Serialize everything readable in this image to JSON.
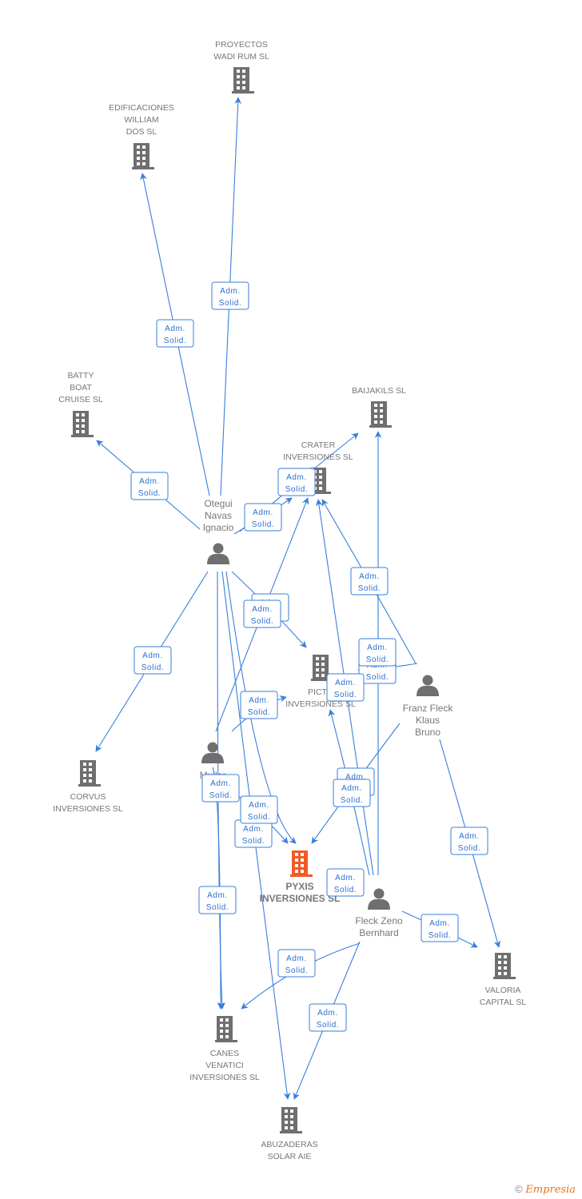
{
  "colors": {
    "edge": "#3a7fdc",
    "node": "#6f6f6f",
    "main_node": "#f05a28"
  },
  "nodes": [
    {
      "id": "proyectos",
      "type": "company",
      "lines": [
        "PROYECTOS",
        "WADI RUM SL"
      ]
    },
    {
      "id": "edificaciones",
      "type": "company",
      "lines": [
        "EDIFICACIONES",
        "WILLIAM",
        "DOS SL"
      ]
    },
    {
      "id": "batty",
      "type": "company",
      "lines": [
        "BATTY",
        "BOAT",
        "CRUISE SL"
      ]
    },
    {
      "id": "baijakils",
      "type": "company",
      "lines": [
        "BAIJAKILS SL"
      ]
    },
    {
      "id": "crater",
      "type": "company",
      "lines": [
        "CRATER",
        "INVERSIONES SL"
      ]
    },
    {
      "id": "otegui",
      "type": "person",
      "lines": [
        "Otegui",
        "Navas",
        "Ignacio"
      ]
    },
    {
      "id": "picto",
      "type": "company",
      "lines": [
        "PICTO",
        "INVERSIONES SL"
      ]
    },
    {
      "id": "franz",
      "type": "person",
      "lines": [
        "Franz Fleck",
        "Klaus",
        "Bruno"
      ]
    },
    {
      "id": "corvus",
      "type": "company",
      "lines": [
        "CORVUS",
        "INVERSIONES SL"
      ]
    },
    {
      "id": "muller",
      "type": "person",
      "lines": [
        "Muller",
        "Je"
      ]
    },
    {
      "id": "pyxis",
      "type": "main",
      "lines": [
        "PYXIS",
        "INVERSIONES SL"
      ]
    },
    {
      "id": "zeno",
      "type": "person",
      "lines": [
        "Fleck Zeno",
        "Bernhard"
      ]
    },
    {
      "id": "valoria",
      "type": "company",
      "lines": [
        "VALORIA",
        "CAPITAL SL"
      ]
    },
    {
      "id": "canes",
      "type": "company",
      "lines": [
        "CANES",
        "VENATICI",
        "INVERSIONES SL"
      ]
    },
    {
      "id": "abuzaderas",
      "type": "company",
      "lines": [
        "ABUZADERAS",
        "SOLAR AIE"
      ]
    }
  ],
  "edges": [
    {
      "from": "otegui",
      "to": "proyectos",
      "role": [
        "Adm.",
        "Solid."
      ]
    },
    {
      "from": "otegui",
      "to": "edificaciones",
      "role": [
        "Adm.",
        "Solid."
      ]
    },
    {
      "from": "otegui",
      "to": "batty",
      "role": [
        "Adm.",
        "Solid."
      ]
    },
    {
      "from": "otegui",
      "to": "crater",
      "role": [
        "Adm.",
        "Solid."
      ]
    },
    {
      "from": "otegui",
      "to": "baijakils",
      "role": [
        "Adm.",
        "Solid."
      ]
    },
    {
      "from": "otegui",
      "to": "picto",
      "role": [
        "Adm.",
        "Solid."
      ]
    },
    {
      "from": "otegui",
      "to": "corvus",
      "role": [
        "Adm.",
        "Solid."
      ]
    },
    {
      "from": "otegui",
      "to": "canes",
      "role": [
        "Adm.",
        "Solid."
      ]
    },
    {
      "from": "otegui",
      "to": "pyxis",
      "role": [
        "Adm.",
        "Solid."
      ]
    },
    {
      "from": "otegui",
      "to": "abuzaderas",
      "role": [
        "Adm.",
        "Solid."
      ]
    },
    {
      "from": "muller",
      "to": "crater",
      "role": [
        "Adm.",
        "Solid."
      ]
    },
    {
      "from": "muller",
      "to": "picto",
      "role": [
        "Adm.",
        "Solid."
      ]
    },
    {
      "from": "muller",
      "to": "canes",
      "role": [
        "Adm.",
        "Solid."
      ]
    },
    {
      "from": "muller",
      "to": "pyxis",
      "role": [
        "Adm.",
        "Solid."
      ]
    },
    {
      "from": "franz",
      "to": "crater",
      "role": [
        "Adm.",
        "Solid."
      ]
    },
    {
      "from": "franz",
      "to": "picto",
      "role": [
        "Adm.",
        "Solid."
      ]
    },
    {
      "from": "franz",
      "to": "pyxis",
      "role": [
        "Adm.",
        "Solid."
      ]
    },
    {
      "from": "franz",
      "to": "valoria",
      "role": [
        "Adm.",
        "Solid."
      ]
    },
    {
      "from": "zeno",
      "to": "baijakils",
      "role": [
        "Adm.",
        "Solid."
      ]
    },
    {
      "from": "zeno",
      "to": "crater",
      "role": [
        "Adm.",
        "Solid."
      ]
    },
    {
      "from": "zeno",
      "to": "picto",
      "role": [
        "Adm.",
        "Solid."
      ]
    },
    {
      "from": "zeno",
      "to": "pyxis",
      "role": [
        "Adm.",
        "Solid."
      ]
    },
    {
      "from": "zeno",
      "to": "valoria",
      "role": [
        "Adm.",
        "Solid."
      ]
    },
    {
      "from": "zeno",
      "to": "canes",
      "role": [
        "Adm.",
        "Solid."
      ]
    },
    {
      "from": "zeno",
      "to": "abuzaderas",
      "role": [
        "Adm.",
        "Solid."
      ]
    }
  ],
  "footer": {
    "copyright": "©",
    "brand": "Empresia"
  }
}
